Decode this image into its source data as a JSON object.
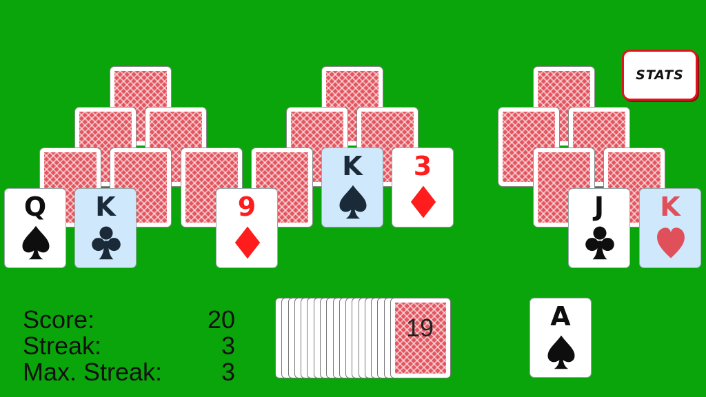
{
  "toolbar": {
    "stats_label": "STATS"
  },
  "tableau": {
    "left": [
      {
        "rank": "Q",
        "suit": "spade",
        "color": "black",
        "highlight": false
      },
      {
        "rank": "K",
        "suit": "club",
        "color": "black",
        "highlight": true
      },
      {
        "rank": "9",
        "suit": "diamond",
        "color": "red",
        "highlight": false
      }
    ],
    "middle": [
      {
        "rank": "K",
        "suit": "spade",
        "color": "black",
        "highlight": true
      },
      {
        "rank": "3",
        "suit": "diamond",
        "color": "red",
        "highlight": false
      }
    ],
    "right": [
      {
        "rank": "J",
        "suit": "club",
        "color": "black",
        "highlight": false
      },
      {
        "rank": "K",
        "suit": "heart",
        "color": "red",
        "highlight": true
      }
    ]
  },
  "stock": {
    "count": "19"
  },
  "waste": {
    "rank": "A",
    "suit": "spade",
    "color": "black"
  },
  "score": {
    "score_label": "Score:",
    "score_value": "20",
    "streak_label": "Streak:",
    "streak_value": "3",
    "max_streak_label": "Max. Streak:",
    "max_streak_value": "3"
  },
  "colors": {
    "felt": "#0aa50a",
    "card_back": "#e3555f",
    "highlight": "#cfe8fb",
    "stats_border": "#e0141c"
  }
}
